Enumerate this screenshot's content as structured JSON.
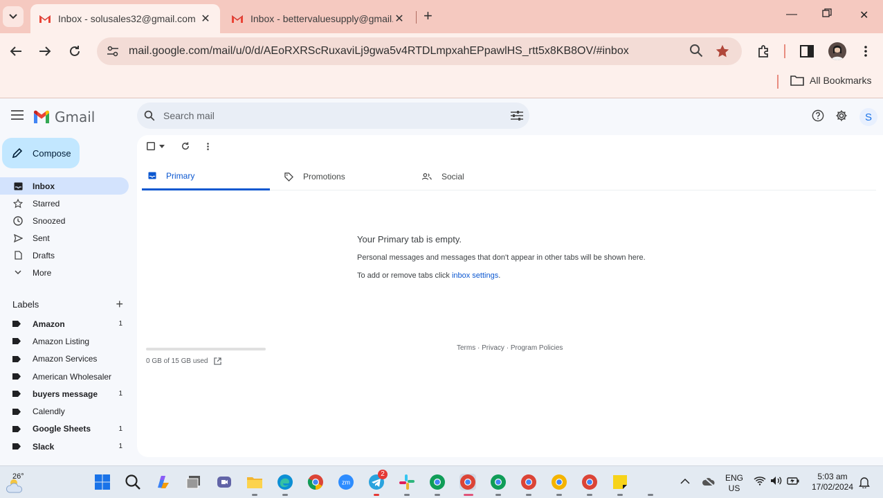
{
  "browser": {
    "tabs": [
      {
        "title": "Inbox - solusales32@gmail.com",
        "active": true
      },
      {
        "title": "Inbox - bettervaluesupply@gmail.com",
        "active": false
      }
    ],
    "url": "mail.google.com/mail/u/0/d/AEoRXRScRuxaviLj9gwa5v4RTDLmpxahEPpawlHS_rtt5x8KB8OV/#inbox",
    "bookmarks_label": "All Bookmarks"
  },
  "gmail": {
    "logo_text": "Gmail",
    "search_placeholder": "Search mail",
    "avatar_letter": "S",
    "compose_label": "Compose",
    "nav": [
      {
        "label": "Inbox",
        "icon": "inbox-icon"
      },
      {
        "label": "Starred",
        "icon": "star-icon"
      },
      {
        "label": "Snoozed",
        "icon": "clock-icon"
      },
      {
        "label": "Sent",
        "icon": "send-icon"
      },
      {
        "label": "Drafts",
        "icon": "draft-icon"
      },
      {
        "label": "More",
        "icon": "chevron-down-icon"
      }
    ],
    "labels_title": "Labels",
    "labels": [
      {
        "name": "Amazon",
        "count": "1",
        "bold": true
      },
      {
        "name": "Amazon Listing",
        "count": "",
        "bold": false
      },
      {
        "name": "Amazon Services",
        "count": "",
        "bold": false
      },
      {
        "name": "American Wholesaler",
        "count": "",
        "bold": false
      },
      {
        "name": "buyers message",
        "count": "1",
        "bold": true
      },
      {
        "name": "Calendly",
        "count": "",
        "bold": false
      },
      {
        "name": "Google Sheets",
        "count": "1",
        "bold": true
      },
      {
        "name": "Slack",
        "count": "1",
        "bold": true
      }
    ],
    "tabs": [
      {
        "label": "Primary",
        "icon": "inbox-icon"
      },
      {
        "label": "Promotions",
        "icon": "tag-icon"
      },
      {
        "label": "Social",
        "icon": "people-icon"
      }
    ],
    "empty": {
      "title": "Your Primary tab is empty.",
      "description": "Personal messages and messages that don't appear in other tabs will be shown here.",
      "settings_prefix": "To add or remove tabs click ",
      "settings_link": "inbox settings",
      "settings_suffix": "."
    },
    "storage": {
      "text": "0 GB of 15 GB used",
      "fraction": 0.0
    },
    "footer": {
      "terms": "Terms",
      "privacy": "Privacy",
      "policies": "Program Policies",
      "separator": " · "
    }
  },
  "taskbar": {
    "weather_temp": "26°",
    "telegram_badge": "2",
    "lang_line1": "ENG",
    "lang_line2": "US",
    "time": "5:03 am",
    "date": "17/02/2024"
  },
  "colors": {
    "tabbar": "#f5c9c0",
    "toolbar": "#fdf0ec",
    "gmail_bg": "#f6f8fc",
    "compose": "#c2e7ff",
    "active_nav": "#d3e3fd",
    "accent": "#0b57d0"
  }
}
